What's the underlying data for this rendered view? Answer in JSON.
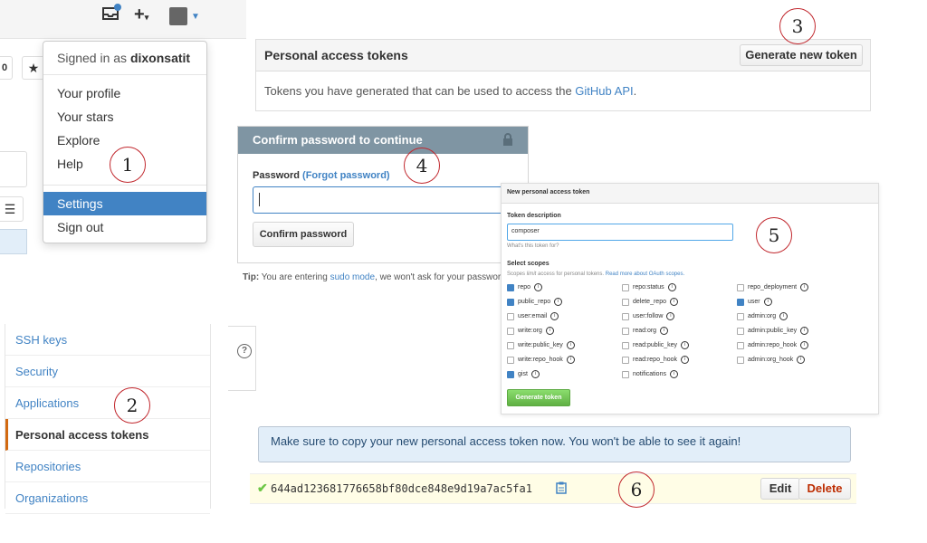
{
  "header": {
    "notifications_icon": "inbox-icon",
    "add_icon": "plus-icon",
    "caret_icon": "caret-down-icon"
  },
  "user_menu": {
    "signed_in_prefix": "Signed in as",
    "username": "dixonsatit",
    "items": [
      "Your profile",
      "Your stars",
      "Explore",
      "Help",
      "Settings",
      "Sign out"
    ]
  },
  "left_fragments": {
    "counter": "0",
    "star_icon": "star-icon",
    "list_icon": "list-icon"
  },
  "tokens_panel": {
    "title": "Personal access tokens",
    "generate_button": "Generate new token",
    "description_prefix": "Tokens you have generated that can be used to access the ",
    "api_link": "GitHub API",
    "description_suffix": "."
  },
  "confirm_panel": {
    "title": "Confirm password to continue",
    "lock_icon": "lock-icon",
    "password_label": "Password",
    "forgot_link": "(Forgot password)",
    "confirm_button": "Confirm password",
    "tip_label": "Tip:",
    "tip_text_prefix": "You are entering ",
    "tip_link": "sudo mode",
    "tip_text_suffix": ", we won't ask for your passwor"
  },
  "new_token_panel": {
    "title": "New personal access token",
    "description_label": "Token description",
    "description_value": "composer",
    "description_hint": "What's this token for?",
    "scopes_title": "Select scopes",
    "scopes_hint_prefix": "Scopes ",
    "scopes_hint_em": "limit",
    "scopes_hint_mid": " access for personal tokens. ",
    "scopes_hint_link": "Read more about OAuth scopes.",
    "scopes": [
      {
        "label": "repo",
        "checked": true
      },
      {
        "label": "repo:status",
        "checked": false
      },
      {
        "label": "repo_deployment",
        "checked": false
      },
      {
        "label": "public_repo",
        "checked": true
      },
      {
        "label": "delete_repo",
        "checked": false
      },
      {
        "label": "user",
        "checked": true
      },
      {
        "label": "user:email",
        "checked": false
      },
      {
        "label": "user:follow",
        "checked": false
      },
      {
        "label": "admin:org",
        "checked": false
      },
      {
        "label": "write:org",
        "checked": false
      },
      {
        "label": "read:org",
        "checked": false
      },
      {
        "label": "admin:public_key",
        "checked": false
      },
      {
        "label": "write:public_key",
        "checked": false
      },
      {
        "label": "read:public_key",
        "checked": false
      },
      {
        "label": "admin:repo_hook",
        "checked": false
      },
      {
        "label": "write:repo_hook",
        "checked": false
      },
      {
        "label": "read:repo_hook",
        "checked": false
      },
      {
        "label": "admin:org_hook",
        "checked": false
      },
      {
        "label": "gist",
        "checked": true
      },
      {
        "label": "notifications",
        "checked": false
      }
    ],
    "generate_button": "Generate token"
  },
  "settings_sidebar": {
    "items": [
      "SSH keys",
      "Security",
      "Applications",
      "Personal access tokens",
      "Repositories",
      "Organizations"
    ],
    "active": "Personal access tokens"
  },
  "help_icon": "question-icon",
  "notice": "Make sure to copy your new personal access token now. You won't be able to see it again!",
  "token": {
    "check_icon": "check-icon",
    "value": "644ad123681776658bf80dce848e9d19a7ac5fa1",
    "copy_icon": "clipboard-icon",
    "edit_button": "Edit",
    "delete_button": "Delete"
  },
  "callouts": [
    "1",
    "2",
    "3",
    "4",
    "5",
    "6"
  ],
  "colors": {
    "link": "#4183c4",
    "selected": "#4183c4",
    "delete": "#bd2c00",
    "callout_ring": "#c1272d",
    "success_green": "#6cc644",
    "notice_bg": "#e2eef9"
  }
}
